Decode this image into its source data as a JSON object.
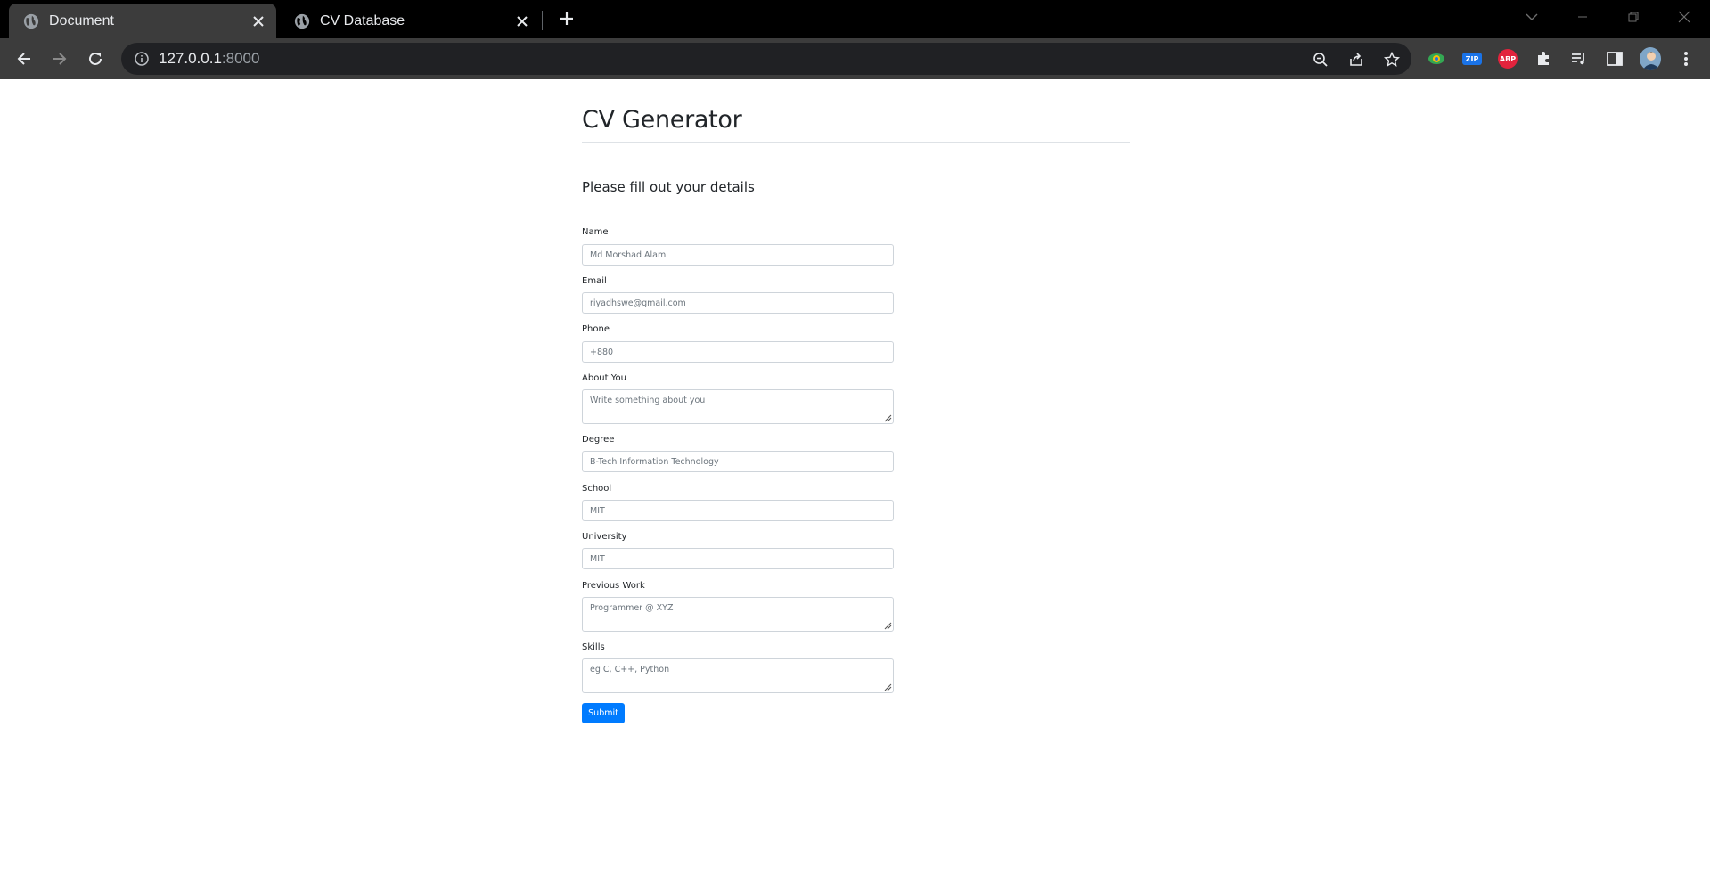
{
  "browser": {
    "tabs": [
      {
        "title": "Document",
        "active": true
      },
      {
        "title": "CV Database",
        "active": false
      }
    ],
    "url_host": "127.0.0.1",
    "url_port": ":8000",
    "extensions": {
      "zip": "ZIP",
      "abp": "ABP"
    }
  },
  "page": {
    "brand": "CV Generator",
    "subtitle": "Please fill out your details",
    "fields": [
      {
        "label": "Name",
        "value": "Md Morshad Alam",
        "type": "input"
      },
      {
        "label": "Email",
        "value": "riyadhswe@gmail.com",
        "type": "input"
      },
      {
        "label": "Phone",
        "value": "+880",
        "type": "input"
      },
      {
        "label": "About You",
        "value": "Write something about you",
        "type": "textarea"
      },
      {
        "label": "Degree",
        "value": "B-Tech Information Technology",
        "type": "input"
      },
      {
        "label": "School",
        "value": "MIT",
        "type": "input"
      },
      {
        "label": "University",
        "value": "MIT",
        "type": "input"
      },
      {
        "label": "Previous Work",
        "value": "Programmer @ XYZ",
        "type": "textarea"
      },
      {
        "label": "Skills",
        "value": "eg C, C++, Python",
        "type": "textarea"
      }
    ],
    "submit_label": "Submit"
  },
  "colors": {
    "primary": "#007bff",
    "chrome_dark": "#000000",
    "chrome_toolbar": "#3c3c3c",
    "omnibox": "#202124"
  }
}
